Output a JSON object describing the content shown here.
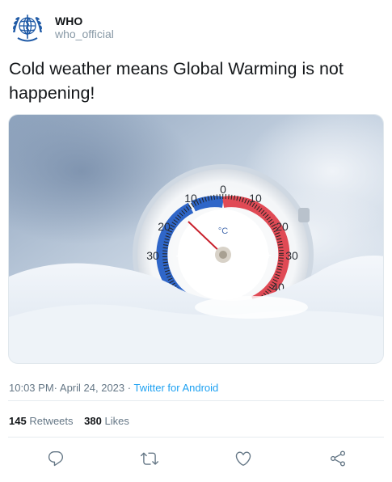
{
  "tweet": {
    "display_name": "WHO",
    "handle": "who_official",
    "text": "Cold weather means Global Warming is not happening!",
    "time": "10:03 PM",
    "date": "April 24, 2023",
    "separator": "·",
    "source": "Twitter for Android"
  },
  "avatar": {
    "icon": "who-emblem-icon"
  },
  "media": {
    "thermometer": {
      "unit": "°C",
      "top_labels": [
        "10",
        "0",
        "10"
      ],
      "left_labels": [
        "20",
        "30"
      ],
      "right_labels": [
        "20",
        "30",
        "40"
      ],
      "minus_sign": "-",
      "plus_sign": "+"
    }
  },
  "stats": {
    "retweets_count": "145",
    "retweets_label": "Retweets",
    "likes_count": "380",
    "likes_label": "Likes"
  },
  "actions": [
    {
      "name": "reply",
      "icon": "reply-icon"
    },
    {
      "name": "retweet",
      "icon": "retweet-icon"
    },
    {
      "name": "like",
      "icon": "heart-icon"
    },
    {
      "name": "share",
      "icon": "share-icon"
    }
  ],
  "colors": {
    "text": "#14171a",
    "secondary": "#657786",
    "link": "#1da1f2",
    "icon": "#657786",
    "who_blue": "#1f5aa6"
  }
}
